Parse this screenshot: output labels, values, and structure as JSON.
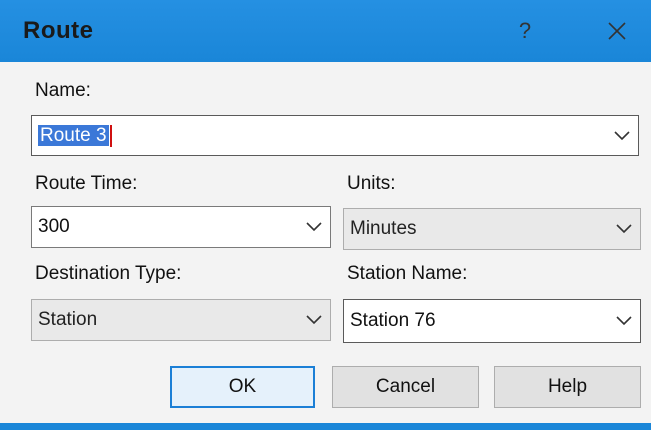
{
  "window": {
    "title": "Route",
    "help_glyph": "?",
    "close_icon": "close-icon",
    "titlebar_color": "#1a86d8"
  },
  "name": {
    "label": "Name:",
    "value": "Route 3"
  },
  "route_time": {
    "label": "Route Time:",
    "value": "300"
  },
  "units": {
    "label": "Units:",
    "value": "Minutes"
  },
  "destination_type": {
    "label": "Destination Type:",
    "value": "Station"
  },
  "station_name": {
    "label": "Station Name:",
    "value": "Station 76"
  },
  "buttons": {
    "ok": "OK",
    "cancel": "Cancel",
    "help": "Help"
  },
  "accent_color": "#1b7fd6",
  "selection_color": "#3b78d8"
}
